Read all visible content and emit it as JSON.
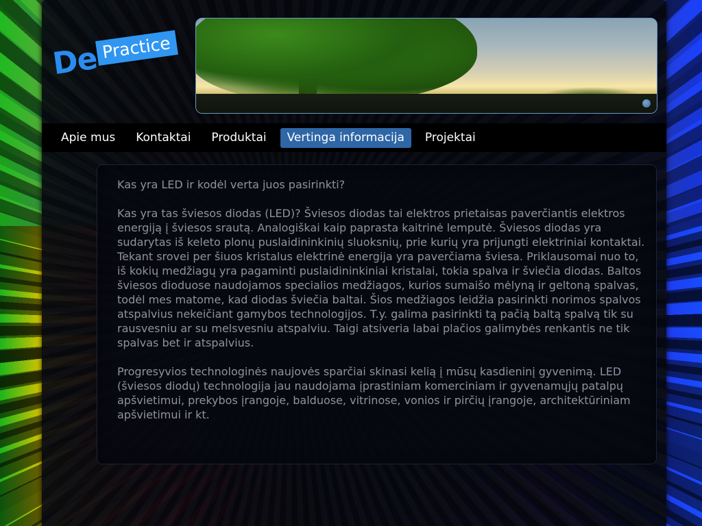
{
  "logo": {
    "part1": "De",
    "part2": "Practice"
  },
  "nav": {
    "items": [
      {
        "label": "Apie mus",
        "active": false
      },
      {
        "label": "Kontaktai",
        "active": false
      },
      {
        "label": "Produktai",
        "active": false
      },
      {
        "label": "Vertinga informacija",
        "active": true
      },
      {
        "label": "Projektai",
        "active": false
      }
    ]
  },
  "article": {
    "title": "Kas yra LED ir kodėl verta juos pasirinkti?",
    "paragraph1": "Kas yra tas šviesos diodas (LED)? Šviesos diodas tai elektros prietaisas paverčiantis elektros energiją į šviesos srautą. Analogiškai kaip paprasta kaitrinė lemputė. Šviesos diodas yra sudarytas iš keleto plonų puslaidininkinių sluoksnių, prie kurių yra prijungti elektriniai kontaktai. Tekant srovei per šiuos kristalus elektrinė energija yra paverčiama šviesa. Priklausomai nuo to, iš kokių medžiagų yra pagaminti puslaidininkiniai kristalai, tokia spalva ir šviečia diodas. Baltos šviesos dioduose naudojamos specialios medžiagos, kurios sumaišo mėlyną ir geltoną spalvas, todėl mes matome, kad diodas šviečia baltai. Šios medžiagos leidžia pasirinkti norimos spalvos atspalvius nekeičiant gamybos technologijos. T.y. galima pasirinkti tą pačią baltą spalvą tik su rausvesniu ar su melsvesniu atspalviu. Taigi atsiveria labai plačios galimybės renkantis ne tik spalvas bet ir atspalvius.",
    "paragraph2": "Progresyvios technologinės naujovės sparčiai skinasi kelią į mūsų kasdieninį gyvenimą. LED (šviesos diodų) technologija jau naudojama įprastiniam komerciniam ir gyvenamųjų patalpų apšvietimui, prekybos įrangoje, balduose, vitrinose, vonios ir pirčių įrangoje, architektūriniam apšvietimui ir kt."
  },
  "colors": {
    "accent": "#2e66a6",
    "logo_blue": "#3096f2",
    "text": "#8f939d"
  }
}
